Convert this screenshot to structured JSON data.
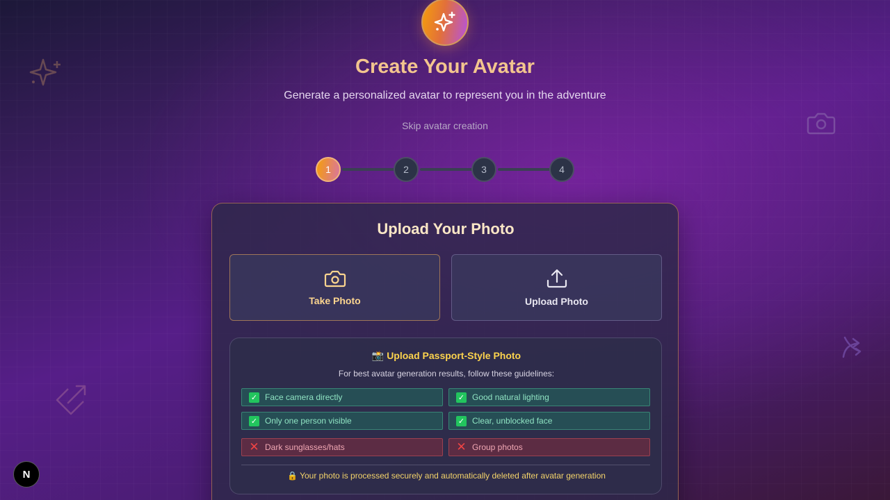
{
  "header": {
    "title": "Create Your Avatar",
    "subtitle": "Generate a personalized avatar to represent you in the adventure",
    "skip_label": "Skip avatar creation"
  },
  "stepper": {
    "current": 1,
    "steps": [
      "1",
      "2",
      "3",
      "4"
    ]
  },
  "upload_card": {
    "title": "Upload Your Photo",
    "take_photo_label": "Take Photo",
    "upload_photo_label": "Upload Photo"
  },
  "guidelines": {
    "title": "📸 Upload Passport-Style Photo",
    "subtitle": "For best avatar generation results, follow these guidelines:",
    "good": [
      "Face camera directly",
      "Good natural lighting",
      "Only one person visible",
      "Clear, unblocked face"
    ],
    "bad": [
      "Dark sunglasses/hats",
      "Group photos"
    ],
    "note": "🔒 Your photo is processed securely and automatically deleted after avatar generation"
  },
  "icons": {
    "logo": "sparkles-icon",
    "take": "camera-icon",
    "upload": "upload-icon",
    "next_badge": "N"
  },
  "colors": {
    "accent_orange": "#f59e0b",
    "title_gold": "#f3c58e",
    "good_green": "#22c55e",
    "bad_red": "#ef4444"
  }
}
